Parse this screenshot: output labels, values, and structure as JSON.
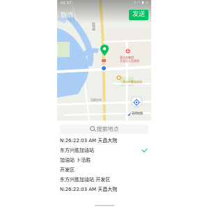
{
  "status_bar": {
    "time": "01:37",
    "icons": [
      "bluetooth-icon",
      "wifi-icon",
      "signal-icon",
      "battery-icon"
    ]
  },
  "header": {
    "cancel_label": "取消",
    "send_label": "发送"
  },
  "map": {
    "labels": {
      "road": "益胜路",
      "hospital_line1": "喜达昌集团",
      "hospital_line2": "开发区人民医院",
      "gas_station": "东方兴胜加油站",
      "village": "冯家庄村"
    },
    "logo_text": "高德地图"
  },
  "search": {
    "placeholder": "搜索地点"
  },
  "results": [
    {
      "title": "N:26:22:03 AM 天昌大院"
    },
    {
      "title": "东方兴胜加油站"
    },
    {
      "title": "加油站 卜沿胜"
    },
    {
      "title": "开发区"
    },
    {
      "title": "东方兴胜加油站 开发区"
    },
    {
      "title": "N:26:22:03 AM 天昌大院"
    }
  ],
  "colors": {
    "accent": "#07c160",
    "location_pin": "#07c160",
    "current_location": "#2e7cf6",
    "river": "#a9cdf5",
    "road_main": "#ffffff",
    "road_highlight": "#f6d98a"
  }
}
